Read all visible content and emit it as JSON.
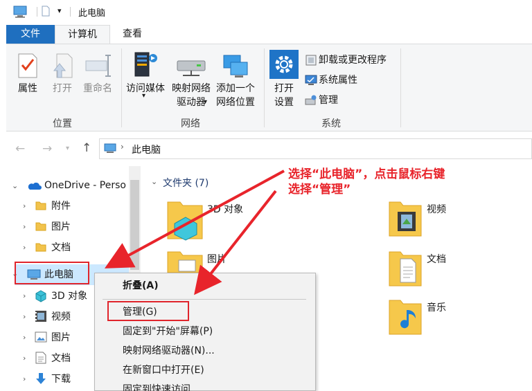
{
  "window": {
    "title": "此电脑"
  },
  "ribbon": {
    "tabs": {
      "file": "文件",
      "computer": "计算机",
      "view": "查看"
    },
    "location_group": {
      "label": "位置",
      "properties": "属性",
      "open": "打开",
      "rename": "重命名"
    },
    "network_group": {
      "label": "网络",
      "access_media": "访问媒体",
      "map_drive_line1": "映射网络",
      "map_drive_line2": "驱动器",
      "add_location_line1": "添加一个",
      "add_location_line2": "网络位置"
    },
    "system_group": {
      "label": "系统",
      "open_settings_line1": "打开",
      "open_settings_line2": "设置",
      "uninstall": "卸载或更改程序",
      "system_properties": "系统属性",
      "manage": "管理"
    }
  },
  "address_bar": {
    "path": "此电脑"
  },
  "nav_pane": {
    "onedrive": "OneDrive - Perso",
    "onedrive_children": [
      "附件",
      "图片",
      "文档"
    ],
    "this_pc": "此电脑",
    "this_pc_children": [
      "3D 对象",
      "视频",
      "图片",
      "文档",
      "下载"
    ]
  },
  "content": {
    "section_header": "文件夹 (7)",
    "folders": {
      "objects3d": "3D 对象",
      "videos": "视频",
      "pictures": "图片",
      "documents": "文档",
      "music": "音乐"
    }
  },
  "context_menu": {
    "collapse": "折叠(A)",
    "manage": "管理(G)",
    "pin_start": "固定到\"开始\"屏幕(P)",
    "map_drive": "映射网络驱动器(N)...",
    "open_new_window": "在新窗口中打开(E)",
    "pin_quick": "固定到快速访问"
  },
  "annotation": {
    "line1": "选择“此电脑”，点击鼠标右键",
    "line2": "选择“管理”",
    "color": "#e8242b"
  }
}
